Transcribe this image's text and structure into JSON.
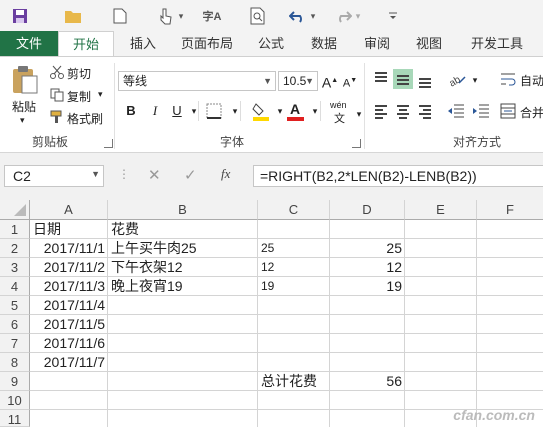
{
  "qat": {
    "icons": [
      "save-icon",
      "open-folder-icon",
      "new-file-icon",
      "touch-mode-icon",
      "spell-check-icon",
      "print-preview-icon",
      "undo-icon",
      "redo-icon",
      "customize-icon"
    ],
    "spell_label": "字A"
  },
  "tabs": [
    "文件",
    "开始",
    "插入",
    "页面布局",
    "公式",
    "数据",
    "审阅",
    "视图",
    "开发工具"
  ],
  "ribbon": {
    "clipboard": {
      "paste": "粘贴",
      "cut": "剪切",
      "copy": "复制",
      "format_painter": "格式刷",
      "group_label": "剪贴板"
    },
    "font": {
      "font_name": "等线",
      "font_size": "10.5",
      "bold": "B",
      "italic": "I",
      "underline": "U",
      "phonetic": "wén",
      "phonetic_sub": "文",
      "group_label": "字体"
    },
    "alignment": {
      "wrap": "自动",
      "merge": "合并",
      "group_label": "对齐方式"
    },
    "colors": {
      "fill": "#ffd800",
      "font_color": "#e02020",
      "accent": "#217346"
    }
  },
  "formula_bar": {
    "name_box": "C2",
    "fx": "fx",
    "formula": "=RIGHT(B2,2*LEN(B2)-LENB(B2))"
  },
  "sheet": {
    "columns": [
      "A",
      "B",
      "C",
      "D",
      "E",
      "F"
    ],
    "rows": [
      "1",
      "2",
      "3",
      "4",
      "5",
      "6",
      "7",
      "8",
      "9",
      "10",
      "11"
    ],
    "cells": {
      "a1": "日期",
      "b1": "花费",
      "a2": "2017/11/1",
      "b2": "上午买牛肉25",
      "c2": "25",
      "d2": "25",
      "a3": "2017/11/2",
      "b3": "下午衣架12",
      "c3": "12",
      "d3": "12",
      "a4": "2017/11/3",
      "b4": "晚上夜宵19",
      "c4": "19",
      "d4": "19",
      "a5": "2017/11/4",
      "a6": "2017/11/5",
      "a7": "2017/11/6",
      "a8": "2017/11/7",
      "c9": "总计花费",
      "d9": "56"
    }
  },
  "watermark": "cfan.com.cn"
}
